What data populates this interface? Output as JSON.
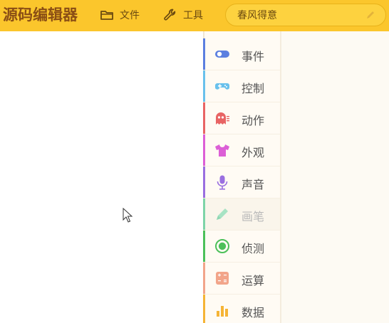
{
  "header": {
    "logo": "源码编辑器",
    "file_label": "文件",
    "tools_label": "工具",
    "project_title": "春风得意"
  },
  "categories": [
    {
      "label": "事件",
      "icon": "toggle-icon",
      "color": "#5b7fe0"
    },
    {
      "label": "控制",
      "icon": "gamepad-icon",
      "color": "#69c1ec"
    },
    {
      "label": "动作",
      "icon": "ghost-icon",
      "color": "#e86464"
    },
    {
      "label": "外观",
      "icon": "shirt-icon",
      "color": "#dc5fd6"
    },
    {
      "label": "声音",
      "icon": "microphone-icon",
      "color": "#9a6fe0"
    },
    {
      "label": "画笔",
      "icon": "pen-icon",
      "color": "#7ed4a8",
      "disabled": true
    },
    {
      "label": "侦测",
      "icon": "radar-icon",
      "color": "#4cc05a"
    },
    {
      "label": "运算",
      "icon": "calculator-icon",
      "color": "#f2a58a"
    },
    {
      "label": "数据",
      "icon": "bar-chart-icon",
      "color": "#f5b436"
    }
  ],
  "colors": {
    "topbar": "#fbc62c",
    "logo": "#8a4e15"
  }
}
